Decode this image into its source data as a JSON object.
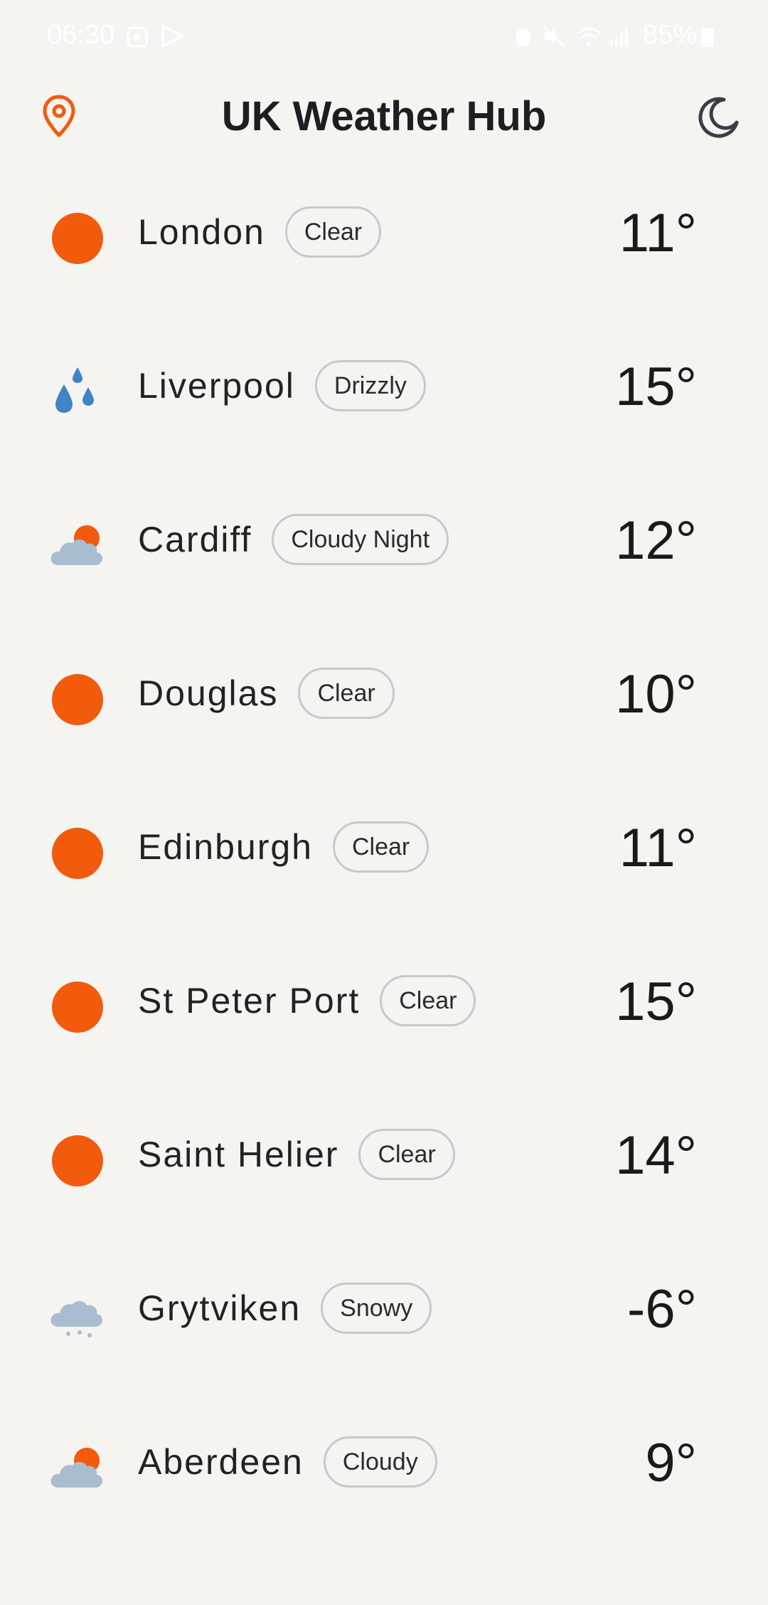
{
  "status_bar": {
    "time": "06:30",
    "battery": "85%"
  },
  "header": {
    "title": "UK Weather Hub",
    "location_icon": "location-pin-icon",
    "theme_icon": "moon-icon"
  },
  "colors": {
    "accent": "#f25a0c",
    "cloud": "#a9bdd0",
    "rain": "#3e84c6"
  },
  "cities": [
    {
      "name": "London",
      "condition": "Clear",
      "temp": "11°",
      "icon": "sun-icon"
    },
    {
      "name": "Liverpool",
      "condition": "Drizzly",
      "temp": "15°",
      "icon": "drizzle-icon"
    },
    {
      "name": "Cardiff",
      "condition": "Cloudy Night",
      "temp": "12°",
      "icon": "cloudy-night-icon"
    },
    {
      "name": "Douglas",
      "condition": "Clear",
      "temp": "10°",
      "icon": "sun-icon"
    },
    {
      "name": "Edinburgh",
      "condition": "Clear",
      "temp": "11°",
      "icon": "sun-icon"
    },
    {
      "name": "St Peter Port",
      "condition": "Clear",
      "temp": "15°",
      "icon": "sun-icon"
    },
    {
      "name": "Saint Helier",
      "condition": "Clear",
      "temp": "14°",
      "icon": "sun-icon"
    },
    {
      "name": "Grytviken",
      "condition": "Snowy",
      "temp": "-6°",
      "icon": "snow-icon"
    },
    {
      "name": "Aberdeen",
      "condition": "Cloudy",
      "temp": "9°",
      "icon": "cloudy-icon"
    }
  ]
}
